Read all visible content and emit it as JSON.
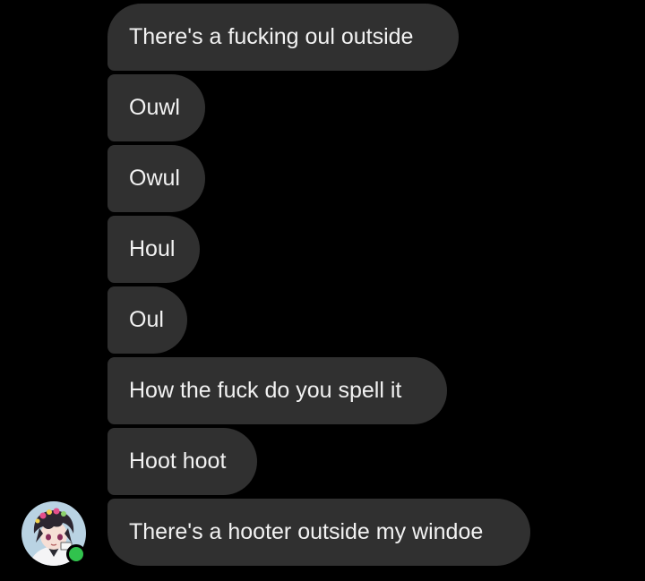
{
  "thread": {
    "messages": [
      {
        "text": "There's a fucking oul outside"
      },
      {
        "text": "Ouwl"
      },
      {
        "text": "Owul"
      },
      {
        "text": "Houl"
      },
      {
        "text": "Oul"
      },
      {
        "text": "How the fuck do you spell it"
      },
      {
        "text": "Hoot hoot"
      },
      {
        "text": "There's a hooter outside my windoe"
      }
    ]
  },
  "sender": {
    "avatar_icon": "user-avatar-anime",
    "presence": "online",
    "presence_color": "#31c24d"
  },
  "colors": {
    "background": "#000000",
    "bubble": "#303030",
    "text": "#f2f2f2"
  }
}
